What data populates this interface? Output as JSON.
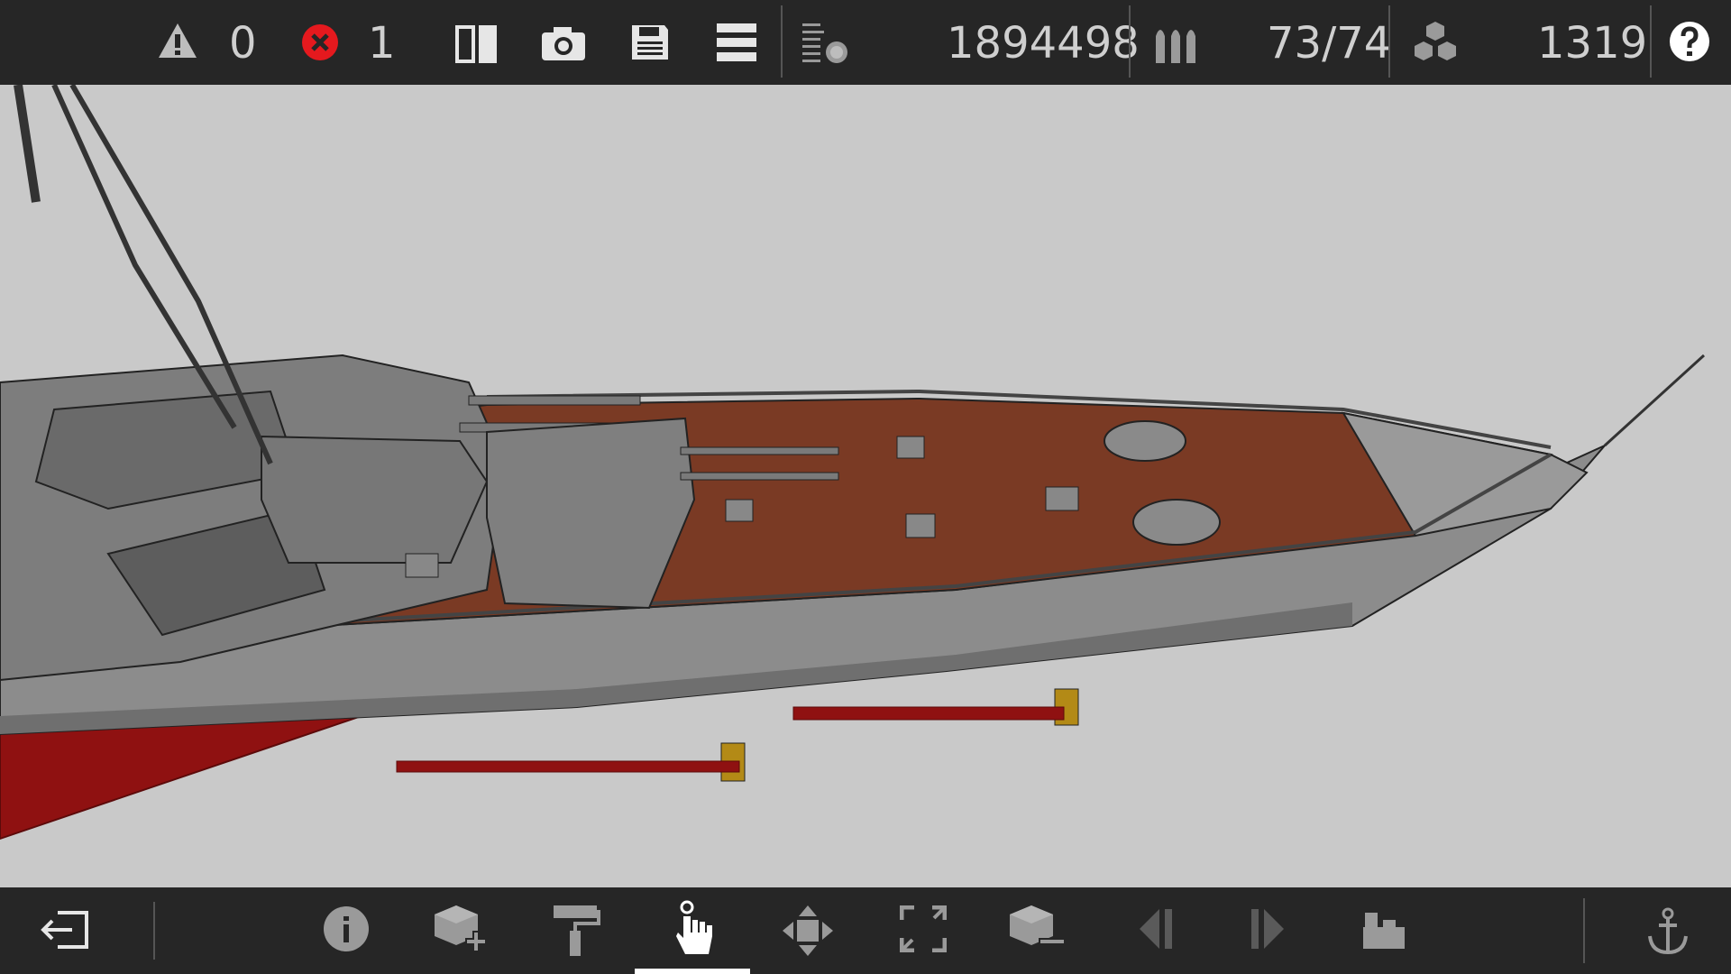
{
  "toolbar": {
    "warnings_count": "0",
    "errors_count": "1",
    "cost_value": "1894498",
    "ammo_value": "73/74",
    "blocks_value": "1319",
    "icons": [
      "warning-icon",
      "error-icon",
      "mirror-icon",
      "camera-icon",
      "save-icon",
      "menu-icon",
      "weight-icon",
      "ammo-icon",
      "blocks-icon",
      "help-icon"
    ]
  },
  "bottom_toolbar": {
    "icons": [
      "exit-icon",
      "info-icon",
      "add-block-icon",
      "paint-roller-icon",
      "hand-select-icon",
      "move-icon",
      "resize-icon",
      "remove-block-icon",
      "previous-icon",
      "next-icon",
      "camera-view-icon",
      "anchor-icon"
    ],
    "active_tool": "hand-select-icon"
  },
  "colors": {
    "toolbar_bg": "#262626",
    "viewport_bg": "#c9c9c9",
    "deck": "#7a3a24",
    "hull": "#8a8a8a",
    "hull_below": "#8f1111",
    "error_red": "#e5191e"
  }
}
